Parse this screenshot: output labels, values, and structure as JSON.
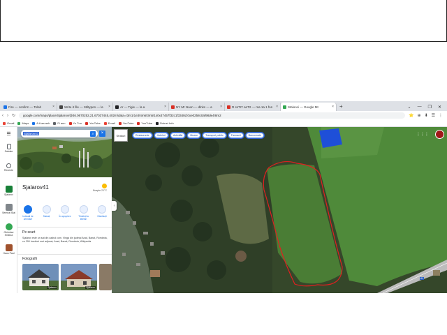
{
  "browser": {
    "tabs": [
      {
        "label": "Fire — confirm — Telah",
        "color": "#1a73e8"
      },
      {
        "label": "Write it file — Stiltypen — la",
        "color": "#444444"
      },
      {
        "label": "Ar — Tigie — la a",
        "color": "#202124"
      },
      {
        "label": "NY Mr Noon — dlnks — a",
        "color": "#d93025"
      },
      {
        "label": "R ssTIY anT2 — ma 1a 1 fnn",
        "color": "#d93025"
      },
      {
        "label": "Stalooci — Google Mt",
        "color": "#34a853",
        "active": true
      }
    ],
    "new_tab": "+",
    "window_controls": [
      "⌄",
      "—",
      "❐",
      "✕"
    ],
    "url": "google.com/maps/place/Sjalarov/@46.0670252,21.67037445,402m/data=!3m1!1e3!4m6!3m5!1s0x47457f32c1f3348d:0xe0258c0af98de4!8m2",
    "toolbar_icons": [
      "⭐",
      "⊕",
      "⬇",
      "☰",
      "⋮"
    ],
    "bookmarks": [
      {
        "label": "Gmail",
        "color": "#ea4335"
      },
      {
        "label": "Maps",
        "color": "#34a853"
      },
      {
        "label": "A A aa anh",
        "color": "#1a73e8"
      },
      {
        "label": "Fi ann",
        "color": "#5f6368"
      },
      {
        "label": "Yo Tnn",
        "color": "#d93025"
      },
      {
        "label": "YouTube",
        "color": "#d93025"
      },
      {
        "label": "Email",
        "color": "#ea4335"
      },
      {
        "label": "YouTube",
        "color": "#d93025"
      },
      {
        "label": "YouTube",
        "color": "#d93025"
      },
      {
        "label": "Dotnet Info",
        "color": "#202124"
      }
    ]
  },
  "rail": {
    "menu": "☰",
    "items": [
      {
        "label": "Salvate",
        "icon_color": "#5f6368"
      },
      {
        "label": "Recente",
        "icon_color": "#5f6368"
      },
      {
        "label": "Sjalarov",
        "icon_color": "#188038"
      },
      {
        "label": "Semnal Stai",
        "icon_color": "#80868b"
      },
      {
        "label": "Ghimbav Sinteza",
        "icon_color": "#34a853"
      },
      {
        "label": "Haus Paul",
        "icon_color": "#a0522d"
      }
    ]
  },
  "panel": {
    "search_value": "Sjalarov41",
    "place_title": "Sjalarov41",
    "weather": "Noapte 21°C",
    "actions": [
      {
        "label": "Indicații de orientare",
        "primary": true
      },
      {
        "label": "Salvați"
      },
      {
        "label": "În apropiere"
      },
      {
        "label": "Trimiteți la telefon"
      },
      {
        "label": "Distribuiți"
      }
    ],
    "overview_heading": "Pe scurt",
    "overview_text": "Sjalarov este un sat din cadrul com. Vinga din județul Arad, Banat, România, cu 290 locuitori mai adjucaț. Arad, Banat, România, Wikipedia",
    "photos_heading": "Fotografii",
    "photos": [
      {
        "label": "Sjalarov"
      },
      {
        "label": "Sjalarov"
      }
    ]
  },
  "map": {
    "layers_label": "Straturi",
    "chips": [
      "Restaurante",
      "Hoteluri",
      "Activități",
      "Muzee",
      "Transport public",
      "Farmacii",
      "Bancomate"
    ],
    "apps_icon": "⋮⋮⋮",
    "road_sign": "A1"
  },
  "colors": {
    "accent": "#1a73e8",
    "outline": "#e02020",
    "field": "#4f8a3a"
  }
}
